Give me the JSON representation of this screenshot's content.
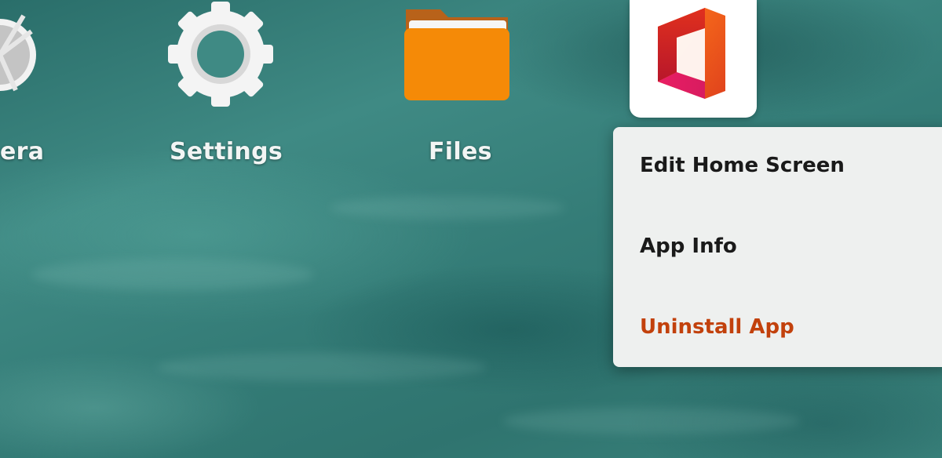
{
  "home_screen": {
    "apps": [
      {
        "label": "era",
        "icon": "camera-icon"
      },
      {
        "label": "Settings",
        "icon": "gear-icon"
      },
      {
        "label": "Files",
        "icon": "folder-icon"
      },
      {
        "label": "",
        "icon": "office-icon"
      }
    ]
  },
  "context_menu": {
    "items": [
      {
        "label": "Edit Home Screen",
        "color": "#1a1a1a"
      },
      {
        "label": "App Info",
        "color": "#1a1a1a"
      },
      {
        "label": "Uninstall App",
        "color": "#c2410c"
      }
    ]
  },
  "colors": {
    "menu_background": "#eef0ef",
    "destructive_accent": "#c2410c",
    "folder": "#f58a07"
  }
}
